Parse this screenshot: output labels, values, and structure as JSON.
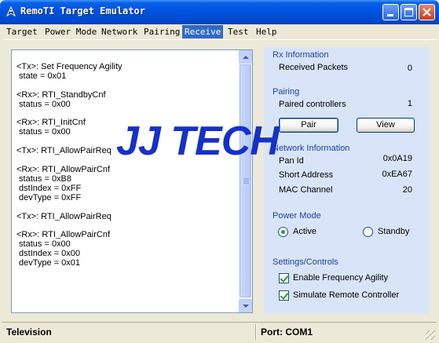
{
  "window": {
    "title": "RemoTI Target Emulator"
  },
  "menu": [
    {
      "label": "Target"
    },
    {
      "label": "Power Mode"
    },
    {
      "label": "Network"
    },
    {
      "label": "Pairing"
    },
    {
      "label": "Receive",
      "active": true
    },
    {
      "label": "Test"
    },
    {
      "label": "Help"
    }
  ],
  "log": {
    "text": "<Tx>: Set Frequency Agility\n state = 0x01\n\n<Rx>: RTI_StandbyCnf\n status = 0x00\n\n<Rx>: RTI_InitCnf\n status = 0x00\n\n<Tx>: RTI_AllowPairReq\n\n<Rx>: RTI_AllowPairCnf\n status = 0xB8\n dstIndex = 0xFF\n devType = 0xFF\n\n<Tx>: RTI_AllowPairReq\n\n<Rx>: RTI_AllowPairCnf\n status = 0x00\n dstIndex = 0x00\n devType = 0x01"
  },
  "rx": {
    "title": "Rx Information",
    "received_label": "Received Packets",
    "received_value": "0"
  },
  "pairing": {
    "title": "Pairing",
    "paired_label": "Paired controllers",
    "paired_value": "1",
    "pair_button": "Pair",
    "view_button": "View"
  },
  "network": {
    "title": "Network Information",
    "pan_label": "Pan Id",
    "pan_value": "0x0A19",
    "short_label": "Short Address",
    "short_value": "0xEA67",
    "channel_label": "MAC Channel",
    "channel_value": "20"
  },
  "power": {
    "title": "Power Mode",
    "active_label": "Active",
    "standby_label": "Standby",
    "selected": "Active"
  },
  "settings": {
    "title": "Settings/Controls",
    "freq_label": "Enable Frequency Agility",
    "freq_checked": true,
    "sim_label": "Simulate Remote Controller",
    "sim_checked": true
  },
  "status": {
    "device": "Television",
    "port": "Port: COM1"
  },
  "watermark": "JJ TECH",
  "colors": {
    "title_bar": "#0052DE",
    "menu_highlight": "#316AC5",
    "section_title": "#1C3FA8",
    "panel_bg": "#D8E4F8",
    "check_green": "#21A121",
    "watermark": "#1531C8"
  }
}
